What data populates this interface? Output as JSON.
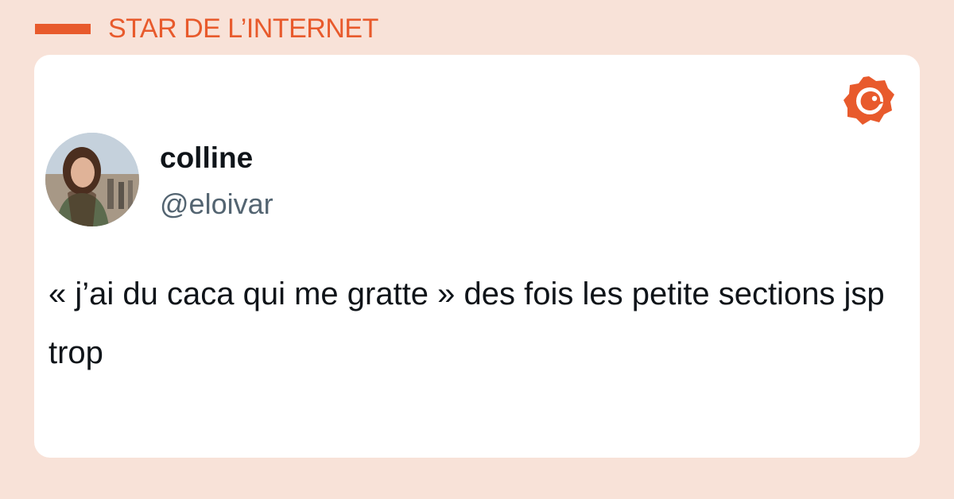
{
  "header": {
    "category_label": "STAR DE L’INTERNET",
    "accent_color": "#e85a2c"
  },
  "brand": {
    "logo_icon": "chick-in-gear-logo"
  },
  "tweet": {
    "author_name": "colline",
    "author_handle": "@eloivar",
    "avatar_icon": "profile-photo",
    "text": "« j’ai du caca qui me gratte » des fois les petite sections jsp trop"
  }
}
